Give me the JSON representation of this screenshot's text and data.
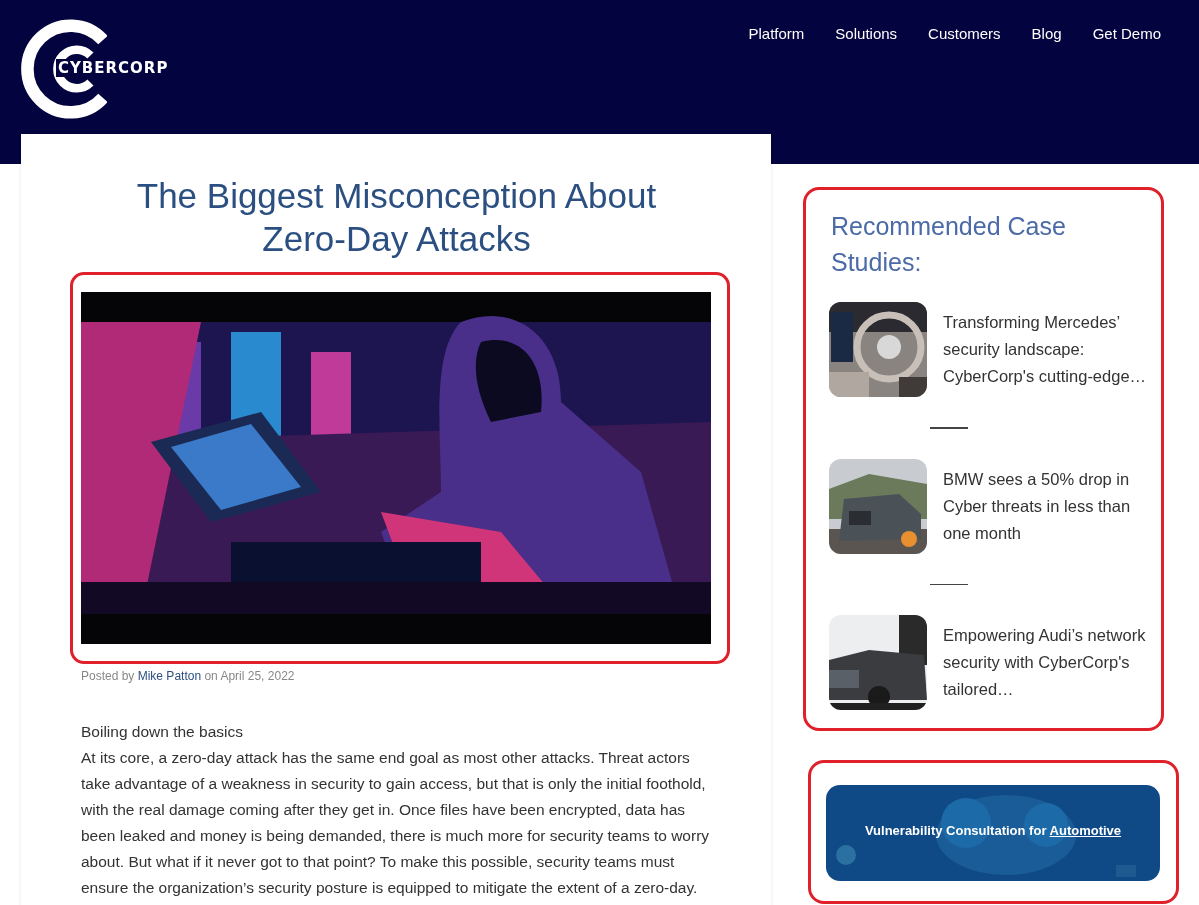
{
  "header": {
    "logo_text": "CYBERCORP",
    "nav": [
      {
        "label": "Platform"
      },
      {
        "label": "Solutions"
      },
      {
        "label": "Customers"
      },
      {
        "label": "Blog"
      },
      {
        "label": "Get Demo"
      }
    ]
  },
  "article": {
    "title": "The Biggest Misconception About Zero-Day Attacks",
    "hero": {
      "kind": "picture",
      "highlighted": true
    },
    "byline": {
      "prefix": "Posted by",
      "author": "Mike Patton",
      "suffix": "on April 25, 2022"
    },
    "subheading": "Boiling down the basics",
    "paragraph": "At its core, a zero-day attack has the same end goal as most other attacks. Threat actors take advantage of a weakness in security to gain access, but that is only the initial foothold, with the real damage coming after they get in. Once files have been encrypted, data has been leaked and money is being demanded, there is much more for security teams to worry about. But what if it never got to that point? To make this possible, security teams must ensure the organization’s security posture is equipped to mitigate the extent of a zero-day."
  },
  "sidebar": {
    "case_studies": {
      "highlighted": true,
      "heading": "Recommended Case Studies:",
      "items": [
        {
          "kind": "interior",
          "title": "Transforming Mercedes’ security landscape: CyberCorp's cutting-edge…"
        },
        {
          "kind": "suv",
          "title": "BMW sees a 50% drop in Cyber threats in less than one month"
        },
        {
          "kind": "sedan",
          "title": "Empowering Audi’s network security with CyberCorp's tailored…"
        }
      ]
    },
    "banner": {
      "highlighted": true,
      "text": "Vulnerability Consultation for",
      "link": "Automotive"
    }
  }
}
